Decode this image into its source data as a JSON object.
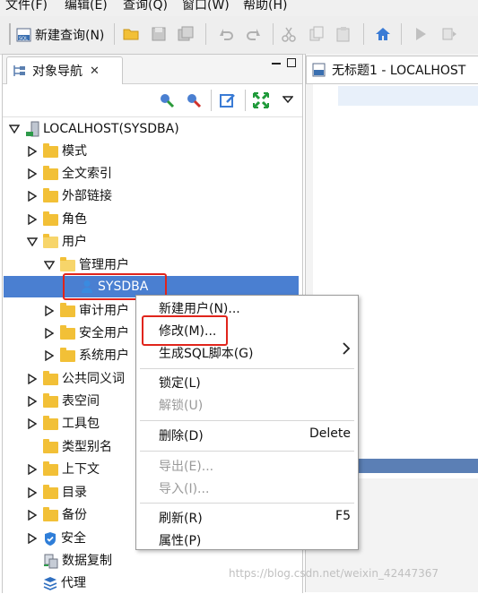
{
  "menubar": [
    "文件(F)",
    "编辑(E)",
    "查询(Q)",
    "窗口(W)",
    "帮助(H)"
  ],
  "toolbar": {
    "new_query_label": "新建查询(N)"
  },
  "left_panel": {
    "tab_title": "对象导航",
    "tab_close": "✕"
  },
  "tree": {
    "root": "LOCALHOST(SYSDBA)",
    "schema": "模式",
    "fulltext": "全文索引",
    "dblink": "外部链接",
    "role": "角色",
    "user": "用户",
    "admin_users": "管理用户",
    "sysdba": "SYSDBA",
    "audit_users": "审计用户",
    "security_users": "安全用户",
    "system_users": "系统用户",
    "public_synonym": "公共同义词",
    "tablespace": "表空间",
    "toolkit": "工具包",
    "type_alias": "类型别名",
    "context": "上下文",
    "directory": "目录",
    "backup": "备份",
    "security": "安全",
    "replication": "数据复制",
    "agent": "代理"
  },
  "right_panel": {
    "tab_title": "无标题1 - LOCALHOST"
  },
  "context_menu": {
    "new_user": "新建用户(N)...",
    "modify": "修改(M)...",
    "gen_sql": "生成SQL脚本(G)",
    "lock": "锁定(L)",
    "unlock": "解锁(U)",
    "delete": "删除(D)",
    "delete_key": "Delete",
    "export": "导出(E)...",
    "import": "导入(I)...",
    "refresh": "刷新(R)",
    "refresh_key": "F5",
    "properties": "属性(P)"
  },
  "watermark": "https://blog.csdn.net/weixin_42447367",
  "colors": {
    "selection": "#4a7fd1",
    "highlight_box": "#e0241b",
    "folder": "#f2c037"
  }
}
